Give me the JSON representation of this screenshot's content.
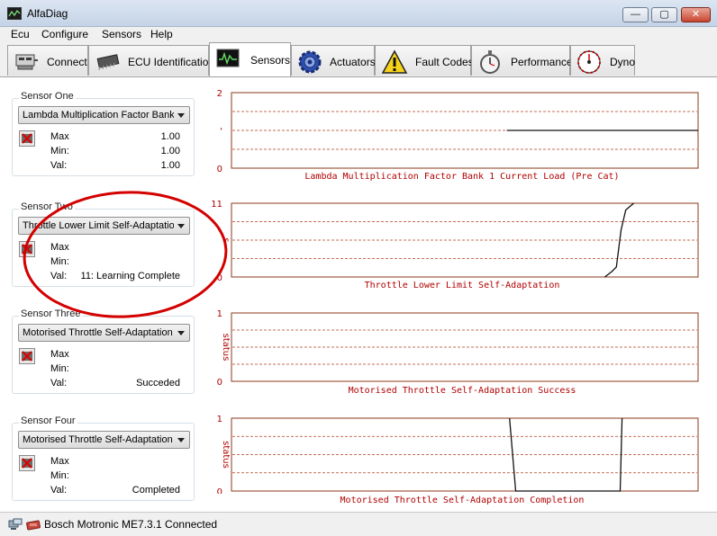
{
  "window": {
    "title": "AlfaDiag",
    "min_symbol": "—",
    "max_symbol": "▢",
    "close_symbol": "✕"
  },
  "menu": [
    "Ecu",
    "Configure",
    "Sensors",
    "Help"
  ],
  "tabs": [
    {
      "label": "Connect",
      "icon": "connect-icon",
      "active": false
    },
    {
      "label": "ECU Identification",
      "icon": "chip-icon",
      "active": false
    },
    {
      "label": "Sensors",
      "icon": "oscilloscope-icon",
      "active": true
    },
    {
      "label": "Actuators",
      "icon": "gear-icon",
      "active": false
    },
    {
      "label": "Fault Codes",
      "icon": "warning-icon",
      "active": false
    },
    {
      "label": "Performance",
      "icon": "stopwatch-icon",
      "active": false
    },
    {
      "label": "Dyno",
      "icon": "dial-icon",
      "active": false
    }
  ],
  "sensors": [
    {
      "title": "Sensor One",
      "selected": "Lambda Multiplication Factor Bank 1 Current Load (Pre Cat)",
      "max_label": "Max",
      "min_label": "Min:",
      "val_label": "Val:",
      "max": "1.00",
      "min": "1.00",
      "val": "1.00"
    },
    {
      "title": "Sensor Two",
      "selected": "Throttle Lower Limit Self-Adaptation",
      "max_label": "Max",
      "min_label": "Min:",
      "val_label": "Val:",
      "max": "",
      "min": "",
      "val": "11: Learning Complete"
    },
    {
      "title": "Sensor Three",
      "selected": "Motorised Throttle Self-Adaptation Success",
      "max_label": "Max",
      "min_label": "Min:",
      "val_label": "Val:",
      "max": "",
      "min": "",
      "val": "Succeded"
    },
    {
      "title": "Sensor Four",
      "selected": "Motorised Throttle Self-Adaptation Completion",
      "max_label": "Max",
      "min_label": "Min:",
      "val_label": "Val:",
      "max": "",
      "min": "",
      "val": "Completed"
    }
  ],
  "chart_data": [
    {
      "type": "line",
      "title": "Lambda Multiplication Factor Bank 1 Current Load (Pre Cat)",
      "ylabel": "",
      "yticks": [
        "2",
        "'",
        "0"
      ],
      "ylim": [
        0,
        2
      ],
      "grid": true,
      "series": [
        {
          "x": [
            0.59,
            1.0
          ],
          "y": [
            1.0,
            1.0
          ]
        }
      ]
    },
    {
      "type": "line",
      "title": "Throttle Lower Limit Self-Adaptation",
      "ylabel": "s",
      "yticks": [
        "11",
        "0"
      ],
      "ylim": [
        0,
        11
      ],
      "grid": true,
      "series": [
        {
          "x": [
            0.8,
            0.815,
            0.825,
            0.835,
            0.845,
            0.862
          ],
          "y": [
            0,
            0.8,
            1.5,
            7.0,
            10.0,
            11.0
          ]
        }
      ]
    },
    {
      "type": "line",
      "title": "Motorised Throttle Self-Adaptation Success",
      "ylabel": "status",
      "yticks": [
        "1",
        "0"
      ],
      "ylim": [
        0,
        1
      ],
      "grid": true,
      "series": []
    },
    {
      "type": "line",
      "title": "Motorised Throttle Self-Adaptation Completion",
      "ylabel": "status",
      "yticks": [
        "1",
        "0"
      ],
      "ylim": [
        0,
        1
      ],
      "grid": true,
      "series": [
        {
          "x": [
            0.596,
            0.609,
            0.833,
            0.837
          ],
          "y": [
            1,
            0,
            0,
            1
          ]
        }
      ]
    }
  ],
  "status": {
    "text": "Bosch Motronic ME7.3.1 Connected"
  },
  "colors": {
    "plot_frame": "#8b3a1a",
    "grid": "#b04020",
    "title_text": "#b00000",
    "annotation": "#d40000"
  }
}
